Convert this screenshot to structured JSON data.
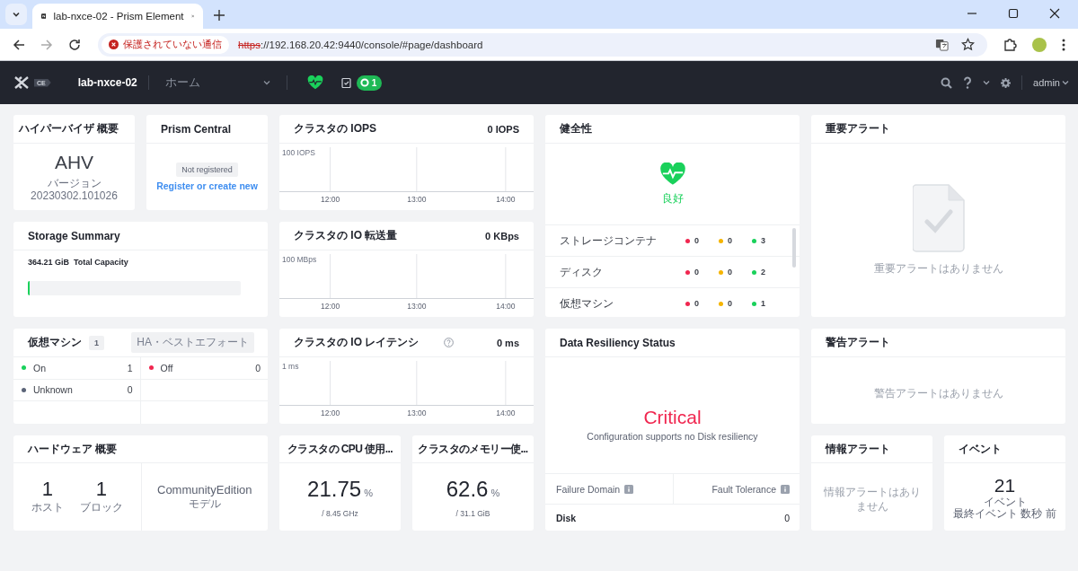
{
  "browser": {
    "tab_title": "lab-nxce-02 - Prism Element",
    "security_label": "保護されていない通信",
    "url_scheme": "https",
    "url_rest": "://192.168.20.42:9440/console/#page/dashboard"
  },
  "header": {
    "logo_badge": "CE",
    "cluster_name": "lab-nxce-02",
    "nav_menu": "ホーム",
    "task_count": "1",
    "user": "admin"
  },
  "hypervisor": {
    "title": "ハイパーバイザ 概要",
    "name": "AHV",
    "version": "バージョン 20230302.101026"
  },
  "prism_central": {
    "title": "Prism Central",
    "status": "Not registered",
    "link": "Register or create new"
  },
  "iops": {
    "title": "クラスタの IOPS",
    "value": "0 IOPS",
    "scale": "100 IOPS",
    "times": [
      "12:00",
      "13:00",
      "14:00"
    ]
  },
  "health": {
    "title": "健全性",
    "status": "良好",
    "rows": [
      {
        "name": "ストレージコンテナ",
        "counts": [
          {
            "count": "0",
            "color": "#f0264f"
          },
          {
            "count": "0",
            "color": "#f5b400"
          },
          {
            "count": "3",
            "color": "#1ad15b"
          }
        ]
      },
      {
        "name": "ディスク",
        "counts": [
          {
            "count": "0",
            "color": "#f0264f"
          },
          {
            "count": "0",
            "color": "#f5b400"
          },
          {
            "count": "2",
            "color": "#1ad15b"
          }
        ]
      },
      {
        "name": "仮想マシン",
        "counts": [
          {
            "count": "0",
            "color": "#f0264f"
          },
          {
            "count": "0",
            "color": "#f5b400"
          },
          {
            "count": "1",
            "color": "#1ad15b"
          }
        ]
      }
    ]
  },
  "critical_alerts": {
    "title": "重要アラート",
    "message": "重要アラートはありません"
  },
  "storage": {
    "title": "Storage Summary",
    "capacity": "364.21 GiB",
    "capacity_label": "Total Capacity",
    "level": 0.01
  },
  "io_throughput": {
    "title": "クラスタの IO 転送量",
    "value": "0 KBps",
    "scale": "100 MBps",
    "times": [
      "12:00",
      "13:00",
      "14:00"
    ]
  },
  "vms": {
    "title": "仮想マシン",
    "count": "1",
    "ha": "HA・ベストエフォート",
    "states": [
      {
        "label": "On",
        "count": "1",
        "color": "#1ad15b"
      },
      {
        "label": "Off",
        "count": "0",
        "color": "#f0264f"
      },
      {
        "label": "Unknown",
        "count": "0",
        "color": "#5b6478"
      }
    ]
  },
  "io_latency": {
    "title": "クラスタの IO レイテンシ",
    "value": "0 ms",
    "scale": "1 ms",
    "times": [
      "12:00",
      "13:00",
      "14:00"
    ]
  },
  "resiliency": {
    "title": "Data Resiliency Status",
    "status": "Critical",
    "message": "Configuration supports no Disk resiliency",
    "col_domain": "Failure Domain",
    "col_tolerance": "Fault Tolerance",
    "domain": "Disk",
    "tolerance": "0"
  },
  "warning_alerts": {
    "title": "警告アラート",
    "message": "警告アラートはありません"
  },
  "hardware": {
    "title": "ハードウェア 概要",
    "stats": [
      {
        "value": "1",
        "label": "ホスト"
      },
      {
        "value": "1",
        "label": "ブロック"
      }
    ],
    "model": "CommunityEdition",
    "model_label": "モデル"
  },
  "cpu": {
    "title": "クラスタの CPU 使用...",
    "value": "21.75",
    "unit": "%",
    "detail": "/ 8.45 GHz"
  },
  "memory": {
    "title": "クラスタのメモリー使...",
    "value": "62.6",
    "unit": "%",
    "detail": "/ 31.1 GiB"
  },
  "info_alerts": {
    "title": "情報アラート",
    "message": "情報アラートはありません"
  },
  "events": {
    "title": "イベント",
    "count": "21",
    "label": "イベント",
    "last": "最終イベント 数秒 前"
  }
}
